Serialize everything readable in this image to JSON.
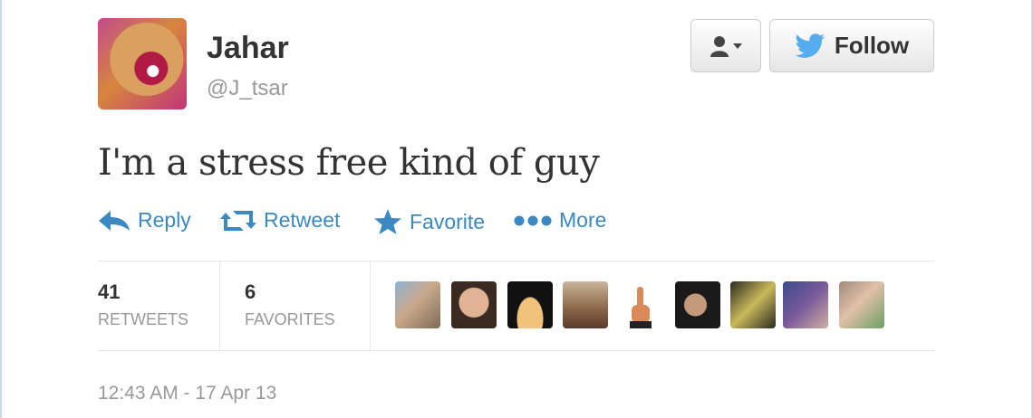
{
  "user": {
    "name": "Jahar",
    "handle": "@J_tsar"
  },
  "header": {
    "follow_label": "Follow"
  },
  "tweet": {
    "text": "I'm a stress free kind of guy",
    "timestamp": "12:43 AM - 17 Apr 13"
  },
  "actions": [
    {
      "label": "Reply",
      "icon": "reply-icon"
    },
    {
      "label": "Retweet",
      "icon": "retweet-icon"
    },
    {
      "label": "Favorite",
      "icon": "star-icon"
    },
    {
      "label": "More",
      "icon": "more-dots-icon"
    }
  ],
  "stats": {
    "retweets": {
      "count": "41",
      "label": "RETWEETS"
    },
    "favorites": {
      "count": "6",
      "label": "FAVORITES"
    }
  },
  "colors": {
    "link_blue": "#3b88c3",
    "twitter_blue": "#55acee",
    "text_dark": "#333333",
    "text_gray": "#999999"
  }
}
